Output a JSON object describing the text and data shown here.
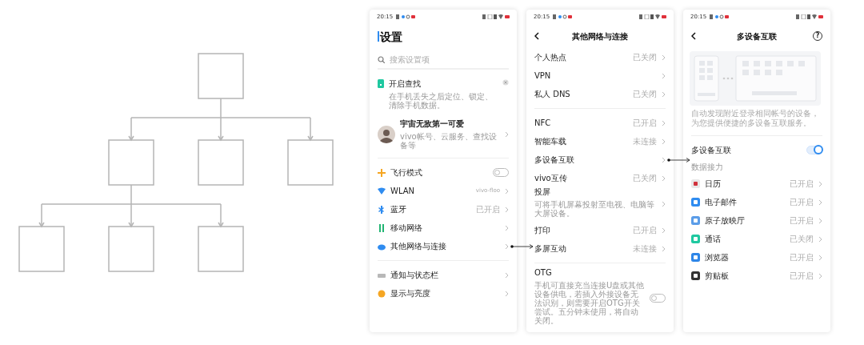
{
  "settings_screen": {
    "status_time": "20:15",
    "title": "设置",
    "search": {
      "placeholder": "搜索设置项"
    },
    "find_card": {
      "title": "开启查找",
      "subtitle": "在手机丢失之后定位、锁定、清除手机数据。"
    },
    "account": {
      "name": "宇宙无敌第一可爱",
      "subtitle": "vivo帐号、云服务、查找设备等"
    },
    "groups": [
      {
        "items": [
          {
            "kind": "toggle",
            "label": "飞行模式",
            "on": false,
            "color": "#f5a623"
          },
          {
            "kind": "link",
            "label": "WLAN",
            "value": "vivo-floo",
            "color": "#2f8cf0"
          },
          {
            "kind": "link",
            "label": "蓝牙",
            "value": "已开启",
            "color": "#2f8cf0"
          },
          {
            "kind": "link",
            "label": "移动网络",
            "color": "#22b573"
          },
          {
            "kind": "link",
            "label": "其他网络与连接",
            "color": "#2f8cf0"
          }
        ]
      },
      {
        "items": [
          {
            "kind": "link",
            "label": "通知与状态栏",
            "color": "#b8b8b8"
          },
          {
            "kind": "link",
            "label": "显示与亮度",
            "color": "#f5a623"
          }
        ]
      }
    ]
  },
  "network_screen": {
    "status_time": "20:15",
    "title": "其他网络与连接",
    "groups": [
      {
        "items": [
          {
            "kind": "link",
            "label": "个人热点",
            "value": "已关闭"
          },
          {
            "kind": "link",
            "label": "VPN"
          },
          {
            "kind": "link",
            "label": "私人 DNS",
            "value": "已关闭"
          }
        ]
      },
      {
        "items": [
          {
            "kind": "link",
            "label": "NFC",
            "value": "已开启"
          },
          {
            "kind": "link",
            "label": "智能车载",
            "value": "未连接"
          },
          {
            "kind": "link",
            "label": "多设备互联"
          },
          {
            "kind": "link",
            "label": "vivo互传",
            "value": "已关闭"
          },
          {
            "kind": "link",
            "label": "投屏",
            "subtitle": "可将手机屏幕投射至电视、电脑等大屏设备。"
          },
          {
            "kind": "link",
            "label": "打印",
            "value": "已开启"
          },
          {
            "kind": "link",
            "label": "多屏互动",
            "value": "未连接"
          }
        ]
      },
      {
        "items": [
          {
            "kind": "toggle",
            "label": "OTG",
            "on": false,
            "subtitle": "手机可直接充当连接U盘或其他设备供电，若插入外接设备无法识别，则需要开启OTG开关尝试。五分钟未使用，将自动关闭。"
          }
        ]
      }
    ]
  },
  "multidevice_screen": {
    "status_time": "20:15",
    "title": "多设备互联",
    "help": "?",
    "description": "自动发现附近登录相同帐号的设备，为您提供便捷的多设备互联服务。",
    "main_toggle": {
      "label": "多设备互联",
      "on": true
    },
    "section": "数据接力",
    "apps": [
      {
        "label": "日历",
        "value": "已开启",
        "color": "#e8e8e8"
      },
      {
        "label": "电子邮件",
        "value": "已开启",
        "color": "#2f8cf0"
      },
      {
        "label": "原子放映厅",
        "value": "已开启",
        "color": "#5b9de8"
      },
      {
        "label": "通话",
        "value": "已关闭",
        "color": "#1fc8a0"
      },
      {
        "label": "浏览器",
        "value": "已开启",
        "color": "#2e86e8"
      },
      {
        "label": "剪贴板",
        "value": "已开启",
        "color": "#333333"
      }
    ]
  }
}
